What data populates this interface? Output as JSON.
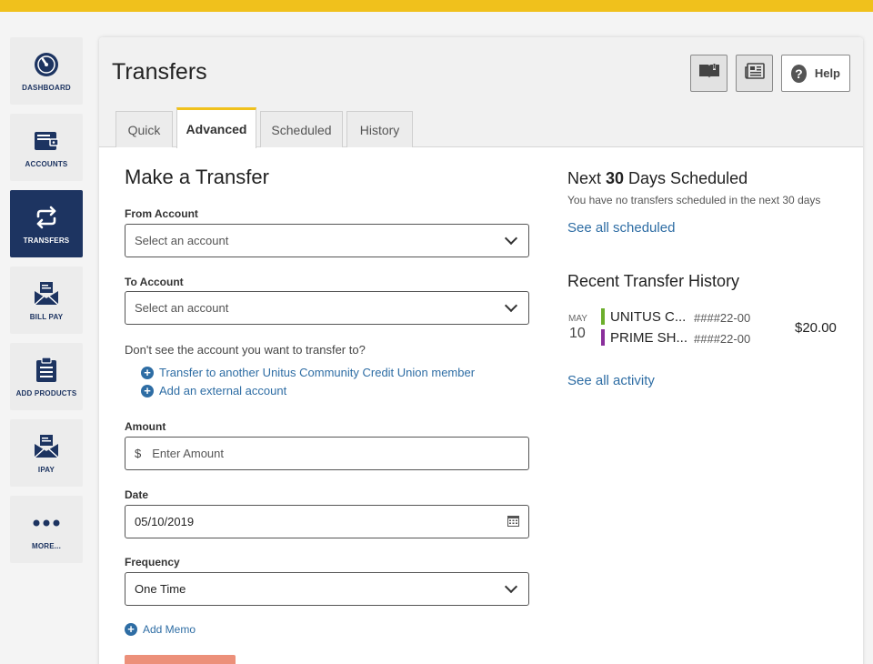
{
  "colors": {
    "accent": "#f0c11c",
    "navy": "#1d3461",
    "link": "#2e6da4",
    "green": "#6cae2c",
    "purple": "#8a2f9b",
    "button": "#ec907a"
  },
  "nav": [
    {
      "label": "DASHBOARD",
      "icon": "dashboard-gauge-icon"
    },
    {
      "label": "ACCOUNTS",
      "icon": "wallet-icon"
    },
    {
      "label": "TRANSFERS",
      "icon": "transfer-arrows-icon",
      "active": true
    },
    {
      "label": "BILL PAY",
      "icon": "envelope-bill-icon"
    },
    {
      "label": "ADD PRODUCTS",
      "icon": "clipboard-icon"
    },
    {
      "label": "IPAY",
      "icon": "envelope-pay-icon"
    },
    {
      "label": "MORE...",
      "icon": "more-dots-icon"
    }
  ],
  "header": {
    "title": "Transfers",
    "help_label": "Help",
    "help_glyph": "?"
  },
  "tabs": [
    "Quick",
    "Advanced",
    "Scheduled",
    "History"
  ],
  "form": {
    "title": "Make a Transfer",
    "from_label": "From Account",
    "from_value": "Select an account",
    "to_label": "To Account",
    "to_value": "Select an account",
    "missing_prompt": "Don't see the account you want to transfer to?",
    "link_member": "Transfer to another Unitus Community Credit Union member",
    "link_external": "Add an external account",
    "amount_label": "Amount",
    "currency_symbol": "$",
    "amount_placeholder": "Enter Amount",
    "date_label": "Date",
    "date_value": "05/10/2019",
    "frequency_label": "Frequency",
    "frequency_value": "One Time",
    "memo_link": "Add Memo"
  },
  "scheduled": {
    "title_pre": "Next ",
    "title_num": "30",
    "title_post": " Days Scheduled",
    "empty_text": "You have no transfers scheduled in the next 30 days",
    "link": "See all scheduled"
  },
  "history": {
    "title": "Recent Transfer History",
    "month": "MAY",
    "day": "10",
    "from_account": "UNITUS C...",
    "from_number": "####22-00",
    "to_account": "PRIME SH...",
    "to_number": "####22-00",
    "amount": "$20.00",
    "link": "See all activity"
  }
}
